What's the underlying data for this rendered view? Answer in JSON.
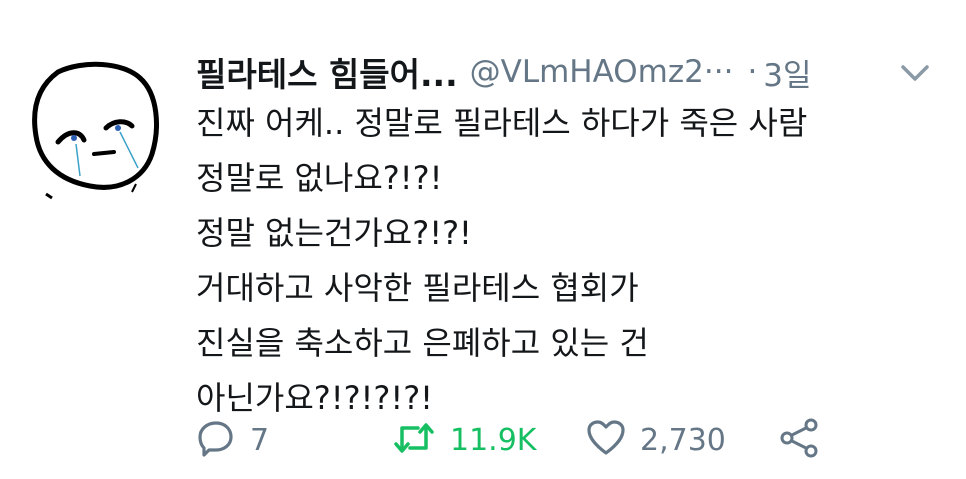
{
  "tweet": {
    "display_name": "필라테스 힘들어...",
    "handle": "@VLmHAOmz2···",
    "separator": "·",
    "time": "3일",
    "body_lines": [
      "진짜 어케.. 정말로 필라테스 하다가 죽은 사람",
      "정말로 없나요?!?!",
      "정말 없는건가요?!?!",
      "거대하고 사악한 필라테스 협회가",
      "진실을 축소하고 은폐하고 있는 건",
      "아닌가요?!?!?!?!"
    ],
    "actions": {
      "reply_count": "7",
      "retweet_count": "11.9K",
      "like_count": "2,730"
    }
  },
  "icons": {
    "reply": "speech-bubble-icon",
    "retweet": "retweet-arrows-icon",
    "like": "heart-icon",
    "share": "share-icon",
    "caret": "chevron-down-icon",
    "avatar": "crying-face-drawing"
  },
  "colors": {
    "text": "#14171a",
    "secondary": "#657786",
    "retweet_active": "#17bf63"
  }
}
